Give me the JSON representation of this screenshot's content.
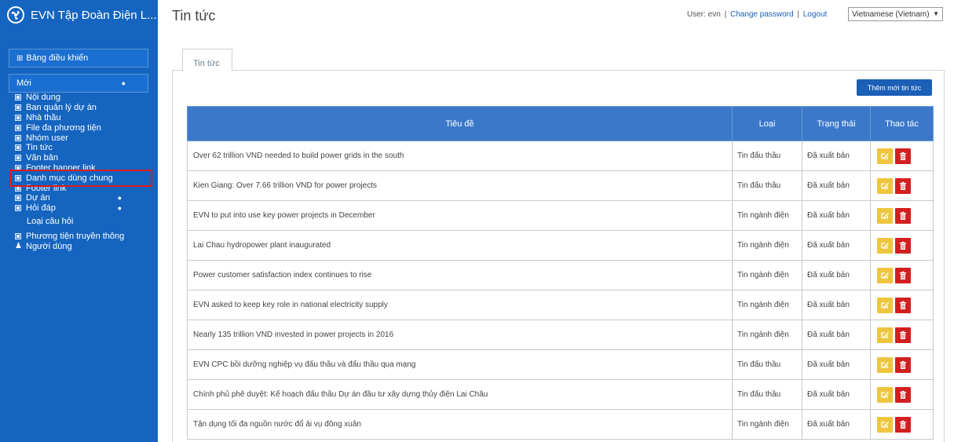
{
  "brand": {
    "title": "EVN Tập Đoàn Điện L...",
    "logo_icon": "evn-fan-logo-icon"
  },
  "sidebar": {
    "dashboard_label": "Bảng điều khiển",
    "new_label": "Mới",
    "items": [
      {
        "label": "Nội dung",
        "type": "page"
      },
      {
        "label": "Ban quản lý dự án",
        "type": "item"
      },
      {
        "label": "Nhà thầu",
        "type": "item"
      },
      {
        "label": "File đa phương tiện",
        "type": "item"
      },
      {
        "label": "Nhóm user",
        "type": "item"
      },
      {
        "label": "Tin tức",
        "type": "item",
        "active": true
      },
      {
        "label": "Văn bản",
        "type": "item"
      },
      {
        "label": "Footer banner link",
        "type": "item"
      },
      {
        "label": "Danh mục dùng chung",
        "type": "item"
      },
      {
        "label": "Footer link",
        "type": "item"
      },
      {
        "label": "Dự án",
        "type": "item",
        "tail": "›"
      },
      {
        "label": "Hỏi đáp",
        "type": "item",
        "tail": "⌄"
      },
      {
        "label": "Loại câu hỏi",
        "type": "sub"
      },
      {
        "label": "Phương tiện truyền thông",
        "type": "media"
      },
      {
        "label": "Người dùng",
        "type": "user"
      }
    ]
  },
  "header": {
    "page_title": "Tin tức",
    "user_text": "User: evn",
    "change_password": "Change password",
    "logout": "Logout",
    "separator": "|",
    "language": "Vietnamese (Vietnam)"
  },
  "tabs": [
    {
      "label": "Tin tức"
    }
  ],
  "actions": {
    "add_label": "Thêm mới tin tức"
  },
  "table": {
    "columns": [
      "Tiêu đề",
      "Loại",
      "Trạng thái",
      "Thao tác"
    ],
    "rows": [
      {
        "title": "Over 62 trillion VND needed to build power grids in the south",
        "type": "Tin đấu thầu",
        "status": "Đã xuất bản"
      },
      {
        "title": "Kien Giang: Over 7.66 trillion VND for power projects",
        "type": "Tin đấu thầu",
        "status": "Đã xuất bản"
      },
      {
        "title": "EVN to put into use key power projects in December",
        "type": "Tin ngành điện",
        "status": "Đã xuất bản"
      },
      {
        "title": "Lai Chau hydropower plant inaugurated",
        "type": "Tin ngành điện",
        "status": "Đã xuất bản"
      },
      {
        "title": "Power customer satisfaction index continues to rise",
        "type": "Tin ngành điện",
        "status": "Đã xuất bản"
      },
      {
        "title": "EVN asked to keep key role in national electricity supply",
        "type": "Tin ngành điện",
        "status": "Đã xuất bản"
      },
      {
        "title": "Nearly 135 trillion VND invested in power projects in 2016",
        "type": "Tin ngành điện",
        "status": "Đã xuất bản"
      },
      {
        "title": "EVN CPC bồi dưỡng nghiệp vụ đấu thầu và đấu thầu qua mạng",
        "type": "Tin đấu thầu",
        "status": "Đã xuất bản"
      },
      {
        "title": "Chính phủ phê duyệt: Kế hoạch đấu thầu Dự án đầu tư xây dựng thủy điện Lai Châu",
        "type": "Tin đấu thầu",
        "status": "Đã xuất bản"
      },
      {
        "title": "Tận dụng tối đa nguồn nước đổ ải vụ đông xuân",
        "type": "Tin ngành điện",
        "status": "Đã xuất bản"
      }
    ]
  },
  "colors": {
    "sidebar_bg": "#1565c0",
    "header_bg": "#3b78c9",
    "edit_btn": "#efc540",
    "delete_btn": "#d31f1f",
    "active_highlight": "#e01818"
  }
}
